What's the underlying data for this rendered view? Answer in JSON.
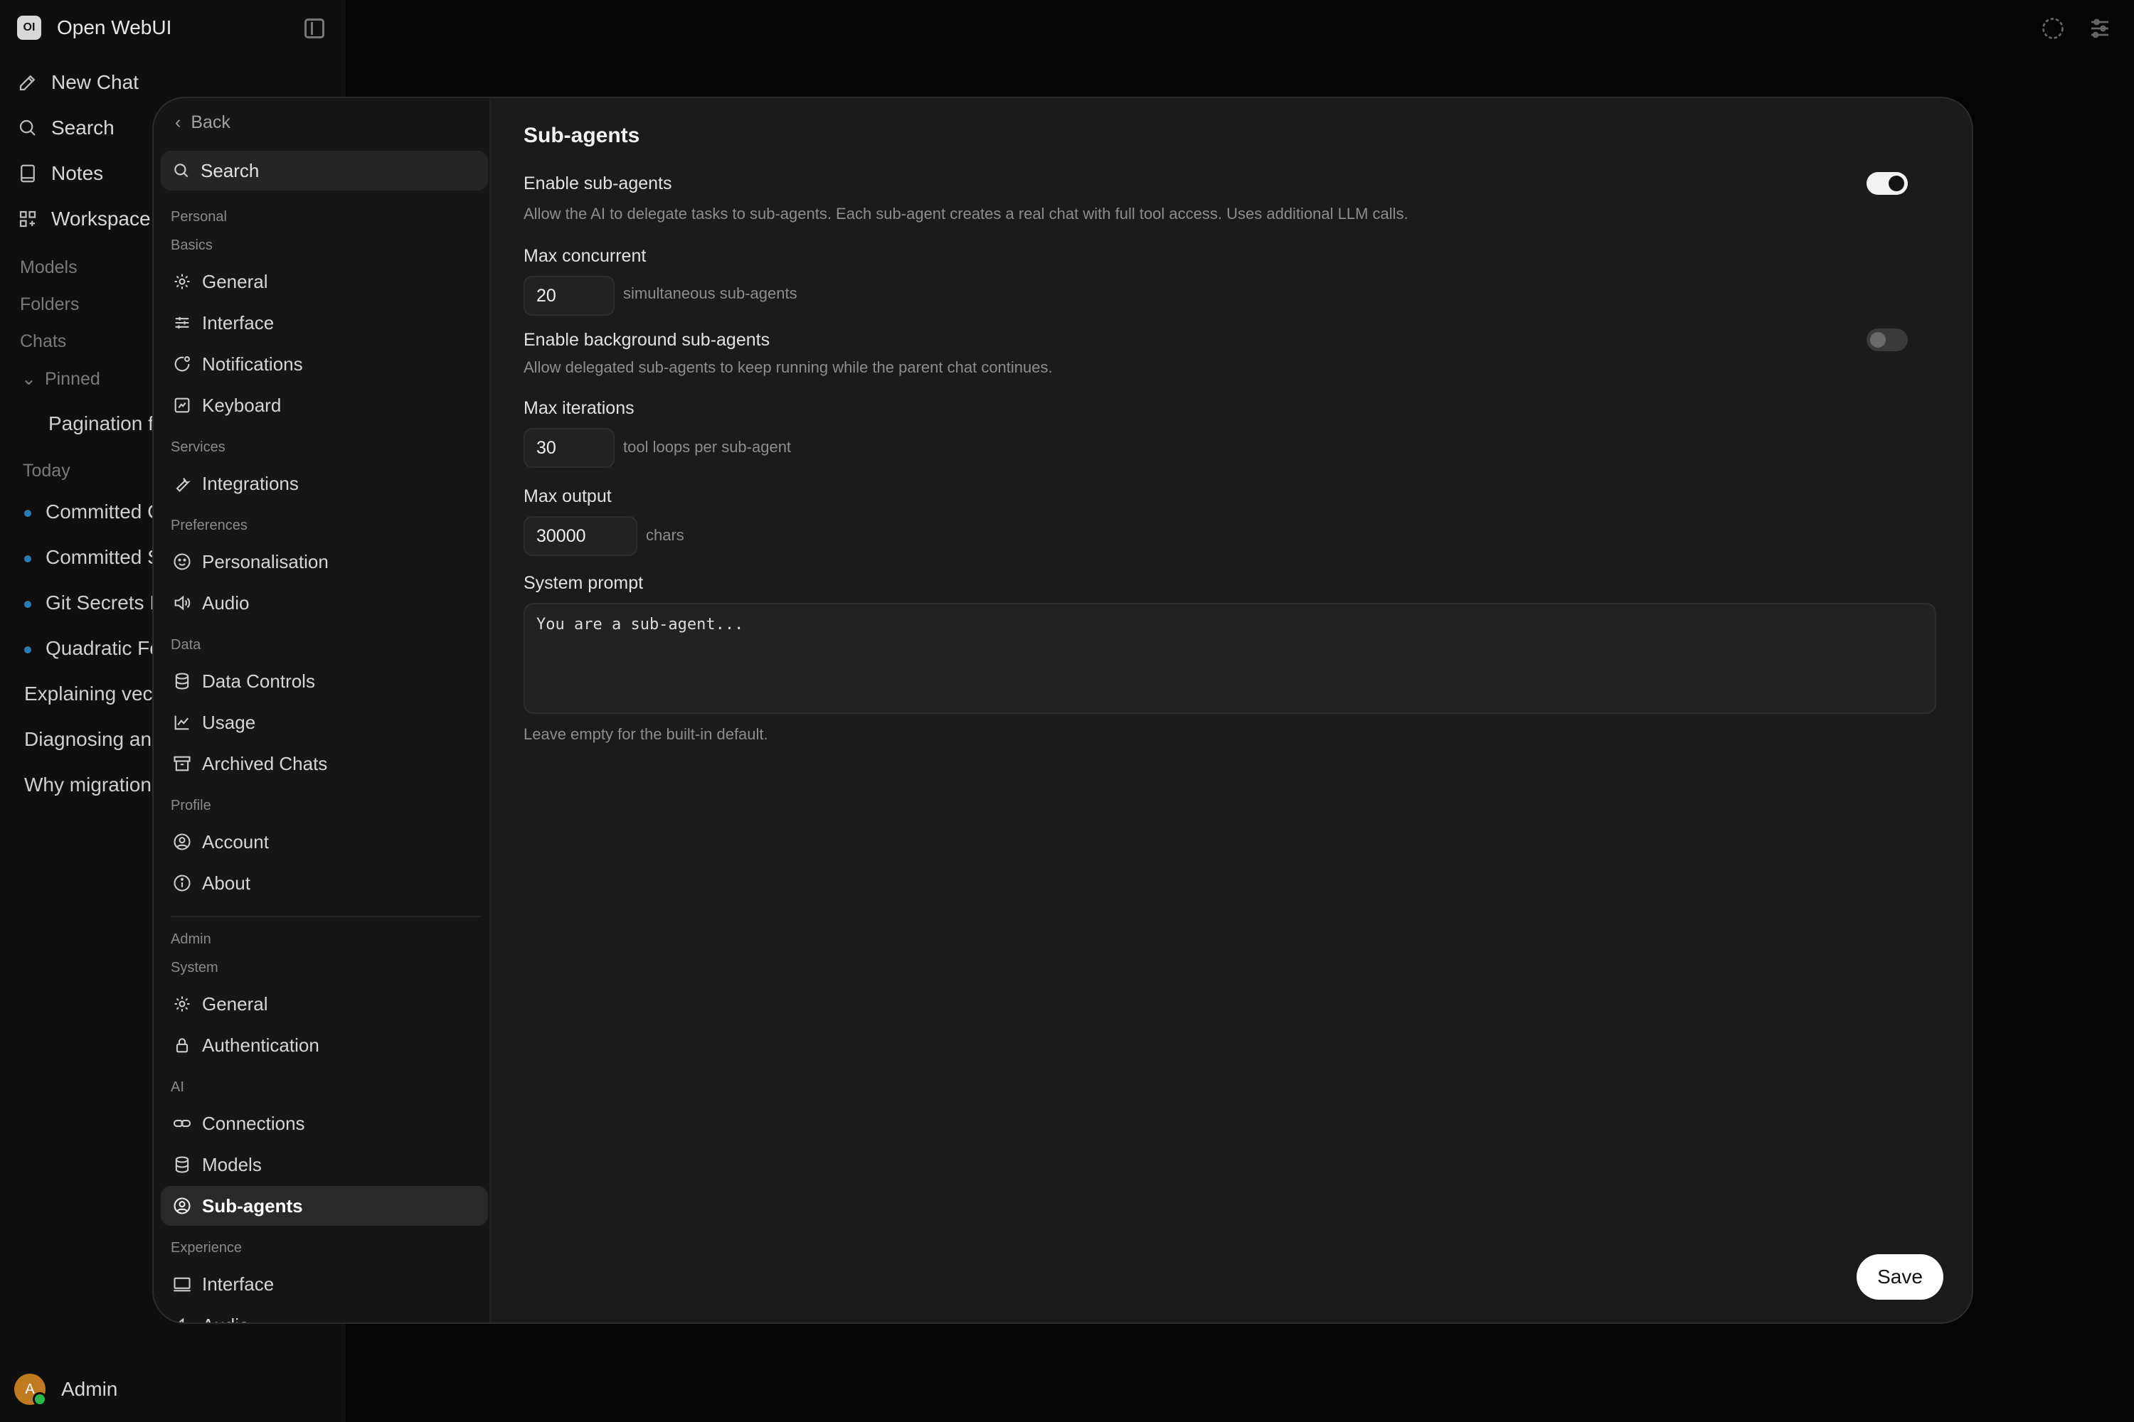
{
  "app": {
    "logo_text": "OI",
    "name": "Open WebUI"
  },
  "nav": {
    "new_chat": "New Chat",
    "search": "Search",
    "notes": "Notes",
    "workspace": "Workspace"
  },
  "sections": {
    "models": "Models",
    "folders": "Folders",
    "chats": "Chats",
    "pinned": "Pinned",
    "today": "Today"
  },
  "chats": {
    "pinned": [
      "Pagination f"
    ],
    "today": [
      "Committed C",
      "Committed S",
      "Git Secrets I",
      "Quadratic Fo"
    ],
    "older": [
      "Explaining vect",
      "Diagnosing an",
      "Why migrations"
    ]
  },
  "user": {
    "initial": "A",
    "name": "Admin"
  },
  "settings_nav": {
    "back": "Back",
    "search": "Search",
    "personal_label": "Personal",
    "basics_label": "Basics",
    "general": "General",
    "interface": "Interface",
    "notifications": "Notifications",
    "keyboard": "Keyboard",
    "services_label": "Services",
    "integrations": "Integrations",
    "preferences_label": "Preferences",
    "personalisation": "Personalisation",
    "audio": "Audio",
    "data_label": "Data",
    "data_controls": "Data Controls",
    "usage": "Usage",
    "archived_chats": "Archived Chats",
    "profile_label": "Profile",
    "account": "Account",
    "about": "About",
    "admin_label": "Admin",
    "system_label": "System",
    "admin_general": "General",
    "authentication": "Authentication",
    "ai_label": "AI",
    "connections": "Connections",
    "models": "Models",
    "sub_agents": "Sub-agents",
    "experience_label": "Experience",
    "exp_interface": "Interface",
    "exp_audio": "Audio"
  },
  "page": {
    "title": "Sub-agents",
    "enable_label": "Enable sub-agents",
    "enable_help": "Allow the AI to delegate tasks to sub-agents. Each sub-agent creates a real chat with full tool access. Uses additional LLM calls.",
    "enable_on": true,
    "max_concurrent_label": "Max concurrent",
    "max_concurrent_value": "20",
    "max_concurrent_unit": "simultaneous sub-agents",
    "background_label": "Enable background sub-agents",
    "background_help": "Allow delegated sub-agents to keep running while the parent chat continues.",
    "background_on": false,
    "max_iterations_label": "Max iterations",
    "max_iterations_value": "30",
    "max_iterations_unit": "tool loops per sub-agent",
    "max_output_label": "Max output",
    "max_output_value": "30000",
    "max_output_unit": "chars",
    "system_prompt_label": "System prompt",
    "system_prompt_placeholder": "You are a sub-agent...",
    "system_prompt_help": "Leave empty for the built-in default.",
    "save_label": "Save"
  }
}
